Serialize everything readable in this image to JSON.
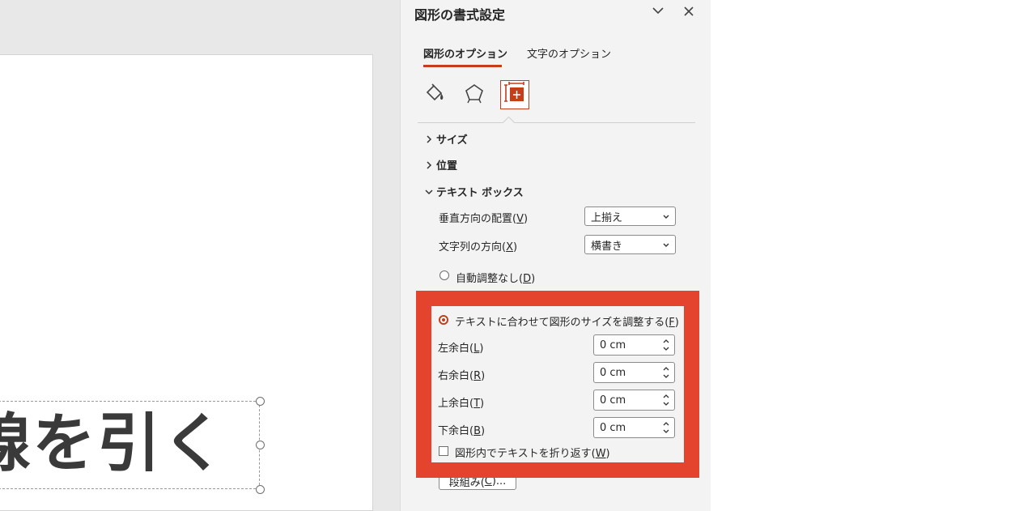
{
  "canvas": {
    "textbox_text": "線を引く"
  },
  "pane": {
    "title": "図形の書式設定",
    "tabs": [
      {
        "label": "図形のオプション",
        "active": true
      },
      {
        "label": "文字のオプション",
        "active": false
      }
    ],
    "icons": [
      "fill-line-icon",
      "effects-pentagon-icon",
      "size-properties-icon"
    ],
    "sections": {
      "size": "サイズ",
      "position": "位置",
      "textbox": "テキスト ボックス"
    },
    "vertical_align": {
      "label_pre": "垂直方向の配置(",
      "key": "V",
      "label_post": ")",
      "value": "上揃え"
    },
    "text_direction": {
      "label_pre": "文字列の方向(",
      "key": "X",
      "label_post": ")",
      "value": "横書き"
    },
    "autofit_none": {
      "label_pre": "自動調整なし(",
      "key": "D",
      "label_post": ")"
    },
    "autofit_resize": {
      "label_pre": "テキストに合わせて図形のサイズを調整する(",
      "key": "F",
      "label_post": ")"
    },
    "margins": {
      "left": {
        "label_pre": "左余白(",
        "key": "L",
        "label_post": ")",
        "value": "0 cm"
      },
      "right": {
        "label_pre": "右余白(",
        "key": "R",
        "label_post": ")",
        "value": "0 cm"
      },
      "top": {
        "label_pre": "上余白(",
        "key": "T",
        "label_post": ")",
        "value": "0 cm"
      },
      "bottom": {
        "label_pre": "下余白(",
        "key": "B",
        "label_post": ")",
        "value": "0 cm"
      }
    },
    "wrap_text": {
      "label_pre": "図形内でテキストを折り返す(",
      "key": "W",
      "label_post": ")"
    },
    "columns_button": {
      "label_pre": "段組み(",
      "key": "C",
      "label_post": ")..."
    }
  },
  "colors": {
    "accent": "#c43e1c",
    "highlight": "#e4432d"
  }
}
